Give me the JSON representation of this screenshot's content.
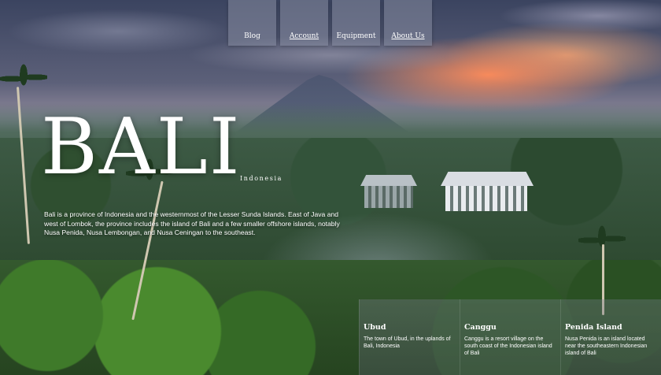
{
  "nav": {
    "items": [
      {
        "label": "Blog"
      },
      {
        "label": "Account"
      },
      {
        "label": "Equipment"
      },
      {
        "label": "About Us"
      }
    ]
  },
  "hero": {
    "title": "BALI",
    "subtitle": "Indonesia",
    "description": "Bali is a province of Indonesia and the westernmost of the Lesser Sunda Islands. East of Java and west of Lombok, the province includes the island of Bali and a few smaller offshore islands, notably Nusa Penida, Nusa Lembongan, and Nusa Ceningan to the southeast."
  },
  "cards": [
    {
      "title": "Ubud",
      "text": "The town of Ubud, in the uplands of Bali, Indonesia"
    },
    {
      "title": "Canggu",
      "text": "Canggu is a resort village on the south coast of the Indonesian island of Bali"
    },
    {
      "title": "Penida Island",
      "text": "Nusa Penida is an island located near the southeastern Indonesian island of Bali"
    }
  ]
}
